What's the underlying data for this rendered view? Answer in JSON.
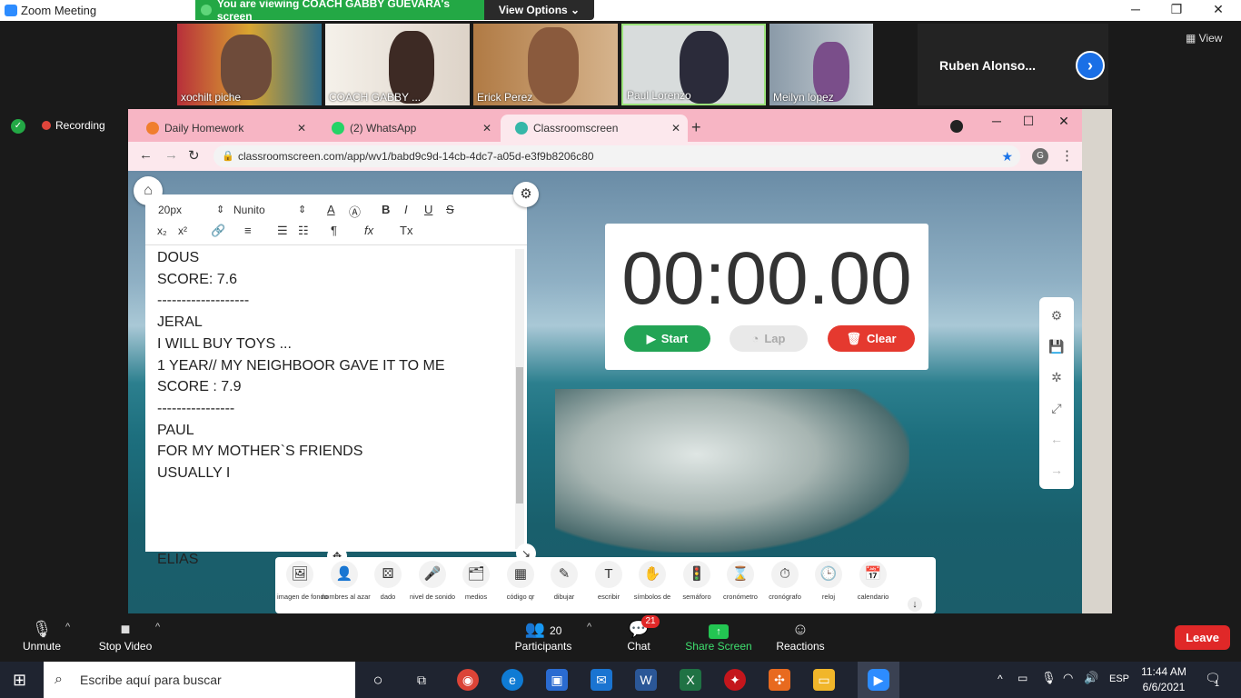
{
  "window": {
    "title": "Zoom Meeting"
  },
  "banner": {
    "viewing_text": "You are viewing COACH GABBY GUEVARA's screen",
    "view_options": "View Options ⌄"
  },
  "participants_strip": {
    "tiles": [
      {
        "name": "xochilt piche",
        "muted": true
      },
      {
        "name": "COACH GABBY ...",
        "muted": false
      },
      {
        "name": "Erick Perez",
        "muted": false
      },
      {
        "name": "Paul Lorenzo",
        "muted": false
      },
      {
        "name": "Meilyn lopez",
        "muted": false
      }
    ],
    "extra_participant": "Ruben  Alonso...",
    "view_label": "View"
  },
  "recording": {
    "label": "Recording"
  },
  "browser": {
    "tabs": [
      {
        "label": "Daily Homework",
        "color": "#f07e2e"
      },
      {
        "label": "(2) WhatsApp",
        "color": "#25d366"
      },
      {
        "label": "Classroomscreen",
        "color": "#35b7a8"
      }
    ],
    "url": "classroomscreen.com/app/wv1/babd9c9d-14cb-4dc7-a05d-e3f9b8206c80",
    "profile_initial": "G"
  },
  "editor": {
    "font_size": "20px",
    "font_name": "Nunito",
    "text": "DOUS\nSCORE: 7.6\n-------------------\nJERAL\nI WILL BUY TOYS ...\n1 YEAR// MY NEIGHBOOR GAVE IT TO ME\nSCORE : 7.9\n----------------\nPAUL\nFOR MY MOTHER`S FRIENDS\nUSUALLY I\n\n\n\nELIAS"
  },
  "stopwatch": {
    "time": "00:00.00",
    "start_label": "Start",
    "lap_label": "Lap",
    "clear_label": "Clear"
  },
  "widgets": [
    {
      "label": "imagen de fondo",
      "icon": "🖼"
    },
    {
      "label": "nombres al azar",
      "icon": "👤"
    },
    {
      "label": "dado",
      "icon": "⚄"
    },
    {
      "label": "nivel de sonido",
      "icon": "🎤"
    },
    {
      "label": "medios",
      "icon": "🗂"
    },
    {
      "label": "código qr",
      "icon": "▦"
    },
    {
      "label": "dibujar",
      "icon": "✎"
    },
    {
      "label": "escribir",
      "icon": "T"
    },
    {
      "label": "símbolos de",
      "icon": "✋"
    },
    {
      "label": "semáforo",
      "icon": "🚦"
    },
    {
      "label": "cronómetro",
      "icon": "⌛"
    },
    {
      "label": "cronógrafo",
      "icon": "⏱"
    },
    {
      "label": "reloj",
      "icon": "🕒"
    },
    {
      "label": "calendario",
      "icon": "📅"
    }
  ],
  "zoom_toolbar": {
    "unmute": "Unmute",
    "stop_video": "Stop Video",
    "participants": "Participants",
    "participant_count": "20",
    "chat": "Chat",
    "chat_badge": "21",
    "share": "Share Screen",
    "reactions": "Reactions",
    "leave": "Leave"
  },
  "taskbar": {
    "search_placeholder": "Escribe aquí para buscar",
    "lang": "ESP",
    "time": "11:44 AM",
    "date": "6/6/2021",
    "notif_count": "1"
  }
}
